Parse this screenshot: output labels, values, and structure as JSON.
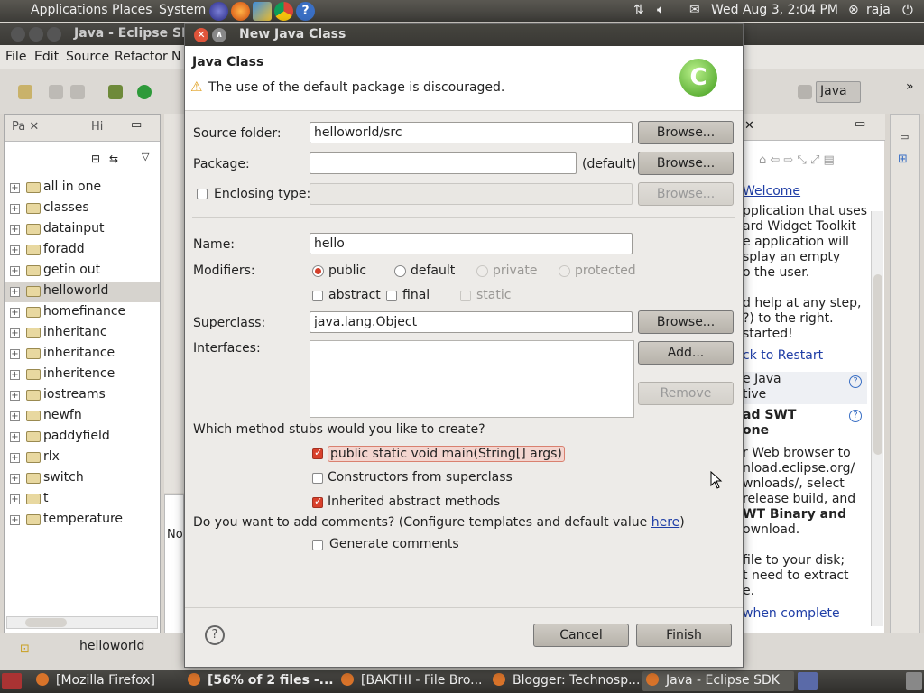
{
  "top_panel": {
    "menus": [
      "Applications",
      "Places",
      "System"
    ],
    "datetime": "Wed Aug  3,  2:04 PM",
    "user": "raja"
  },
  "eclipse": {
    "title": "Java - Eclipse SD",
    "menus": [
      "File",
      "Edit",
      "Source",
      "Refactor",
      "N"
    ],
    "perspective": "Java",
    "explorer_tabs": [
      "Pa",
      "Hi"
    ],
    "projects": [
      "all in one",
      "classes",
      "datainput",
      "foradd",
      "getin out",
      "helloworld",
      "homefinance",
      "inheritanc",
      "inheritance",
      "inheritence",
      "iostreams",
      "newfn",
      "paddyfield",
      "rlx",
      "switch",
      "t",
      "temperature"
    ],
    "selected_project": "helloworld",
    "status_text": "helloworld",
    "bottom_view_tab": "No",
    "help": {
      "welcome_link": "Welcome",
      "text_lines": [
        "pplication that uses",
        "ard Widget Toolkit",
        "e application will",
        "splay an empty",
        "o the user.",
        "",
        "d help at any step,",
        "?) to the right.",
        "started!"
      ],
      "restart_link": "ck to Restart",
      "item1_lines": [
        "e Java",
        "tive"
      ],
      "item2_lines": [
        "ad SWT",
        "one"
      ],
      "body_lines": [
        "r Web browser to",
        "nload.eclipse.org/",
        "wnloads/, select",
        "release build, and",
        "WT Binary and",
        "ownload.",
        "",
        "file to your disk;",
        "t need to extract",
        "e."
      ],
      "bold_line": "WT Binary and",
      "complete_link": "when complete"
    }
  },
  "dialog": {
    "title": "New Java Class",
    "header_title": "Java Class",
    "warning": "The use of the default package is discouraged.",
    "source_folder_label": "Source folder:",
    "source_folder_value": "helloworld/src",
    "package_label": "Package:",
    "package_value": "",
    "package_default": "(default)",
    "enclosing_label": "Enclosing type:",
    "enclosing_value": "",
    "browse": "Browse...",
    "name_label": "Name:",
    "name_value": "hello",
    "modifiers_label": "Modifiers:",
    "modifiers": [
      {
        "label": "public",
        "checked": true,
        "enabled": true
      },
      {
        "label": "default",
        "checked": false,
        "enabled": true
      },
      {
        "label": "private",
        "checked": false,
        "enabled": false
      },
      {
        "label": "protected",
        "checked": false,
        "enabled": false
      }
    ],
    "modifier_checks": [
      {
        "label": "abstract",
        "checked": false,
        "enabled": true
      },
      {
        "label": "final",
        "checked": false,
        "enabled": true
      },
      {
        "label": "static",
        "checked": false,
        "enabled": false
      }
    ],
    "superclass_label": "Superclass:",
    "superclass_value": "java.lang.Object",
    "interfaces_label": "Interfaces:",
    "add_label": "Add...",
    "remove_label": "Remove",
    "stubs_question": "Which method stubs would you like to create?",
    "stubs": [
      {
        "label": "public static void main(String[] args)",
        "checked": true
      },
      {
        "label": "Constructors from superclass",
        "checked": false
      },
      {
        "label": "Inherited abstract methods",
        "checked": true
      }
    ],
    "comments_question": "Do you want to add comments? (Configure templates and default value ",
    "comments_link": "here",
    "comments_suffix": ")",
    "generate_comments": "Generate comments",
    "generate_comments_checked": false,
    "cancel_label": "Cancel",
    "finish_label": "Finish",
    "help_glyph": "?"
  },
  "taskbar": {
    "tasks": [
      "[Mozilla Firefox]",
      "[56% of 2 files -...",
      "[BAKTHI - File Bro...",
      "Blogger: Technosp...",
      "Java - Eclipse SDK"
    ],
    "active_index": 4
  },
  "colors": {
    "accent": "#d33f2a",
    "link": "#1f3ea6"
  }
}
